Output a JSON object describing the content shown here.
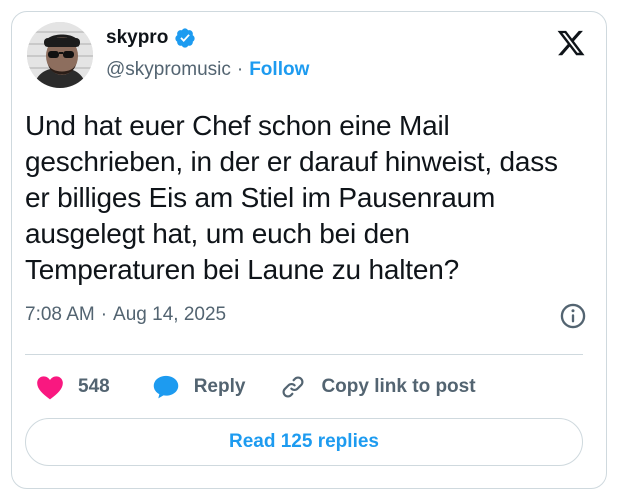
{
  "author": {
    "display_name": "skypro",
    "handle": "@skypromusic",
    "separator": "·",
    "follow_label": "Follow",
    "verified": true
  },
  "tweet": {
    "text": "Und hat euer Chef schon eine Mail geschrieben, in der er darauf hinweist, dass er billiges Eis am Stiel im Pausenraum ausgelegt hat, um euch bei den Temperaturen bei Laune zu halten?",
    "time": "7:08 AM",
    "separator": "·",
    "date": "Aug 14, 2025"
  },
  "actions": {
    "like_count": "548",
    "reply_label": "Reply",
    "copy_label": "Copy link to post"
  },
  "footer": {
    "read_replies_label": "Read 125 replies"
  },
  "colors": {
    "accent": "#1d9bf0",
    "like": "#f91880",
    "muted": "#536471",
    "border": "#cfd9de"
  },
  "icons": [
    "x-logo-icon",
    "verified-badge-icon",
    "info-icon",
    "heart-icon",
    "reply-bubble-icon",
    "link-icon"
  ]
}
